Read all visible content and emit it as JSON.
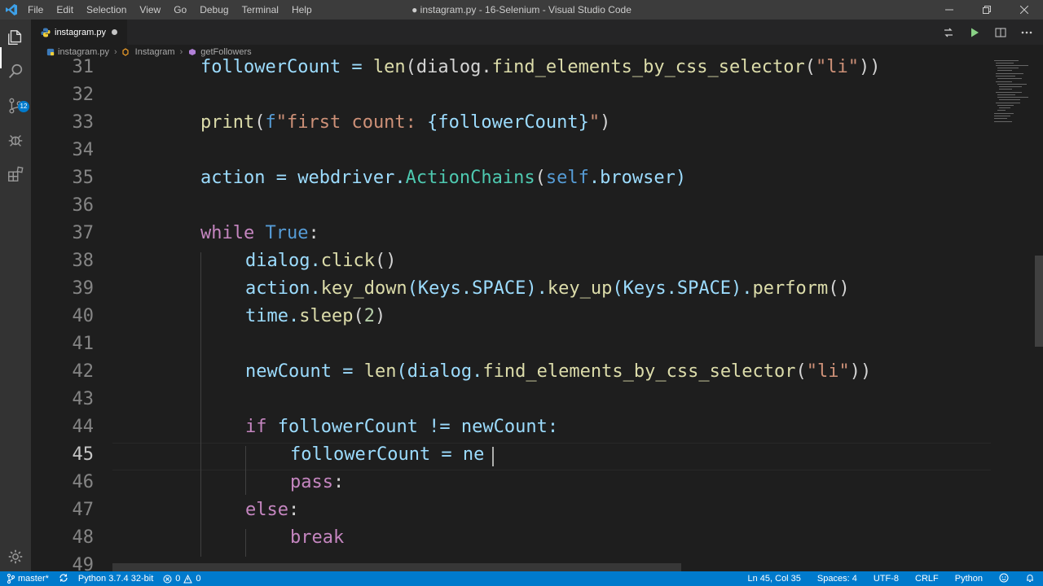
{
  "window": {
    "title": "● instagram.py - 16-Selenium - Visual Studio Code",
    "menu": [
      "File",
      "Edit",
      "Selection",
      "View",
      "Go",
      "Debug",
      "Terminal",
      "Help"
    ]
  },
  "activity": {
    "scm_badge": "12"
  },
  "tabs": [
    {
      "name": "instagram.py",
      "dirty": true
    }
  ],
  "breadcrumb": [
    "instagram.py",
    "Instagram",
    "getFollowers"
  ],
  "editor": {
    "lines": [
      {
        "n": "31",
        "indent": 0
      },
      {
        "n": "32",
        "indent": 0
      },
      {
        "n": "33",
        "indent": 0
      },
      {
        "n": "34",
        "indent": 0
      },
      {
        "n": "35",
        "indent": 0
      },
      {
        "n": "36",
        "indent": 0
      },
      {
        "n": "37",
        "indent": 0
      },
      {
        "n": "38",
        "indent": 1
      },
      {
        "n": "39",
        "indent": 1
      },
      {
        "n": "40",
        "indent": 1
      },
      {
        "n": "41",
        "indent": 1
      },
      {
        "n": "42",
        "indent": 1
      },
      {
        "n": "43",
        "indent": 1
      },
      {
        "n": "44",
        "indent": 1
      },
      {
        "n": "45",
        "indent": 2
      },
      {
        "n": "46",
        "indent": 2
      },
      {
        "n": "47",
        "indent": 1
      },
      {
        "n": "48",
        "indent": 2
      },
      {
        "n": "49",
        "indent": 0
      }
    ],
    "code": {
      "l31": {
        "a": "followerCount = ",
        "b": "len",
        "c": "(dialog.",
        "d": "find_elements_by_css_selector",
        "e": "(",
        "f": "\"li\"",
        "g": "))"
      },
      "l33": {
        "a": "print",
        "b": "(",
        "c": "f",
        "d": "\"first count: ",
        "e": "{followerCount}",
        "f": "\"",
        "g": ")"
      },
      "l35": {
        "a": "action = webdriver.",
        "b": "ActionChains",
        "c": "(",
        "d": "self",
        "e": ".browser)"
      },
      "l37": {
        "a": "while",
        "b": " ",
        "c": "True",
        "d": ":"
      },
      "l38": {
        "a": "dialog.",
        "b": "click",
        "c": "()"
      },
      "l39": {
        "a": "action.",
        "b": "key_down",
        "c": "(Keys.SPACE).",
        "d": "key_up",
        "e": "(Keys.SPACE).",
        "f": "perform",
        "g": "()"
      },
      "l40": {
        "a": "time.",
        "b": "sleep",
        "c": "(",
        "d": "2",
        "e": ")"
      },
      "l42": {
        "a": "newCount = ",
        "b": "len",
        "c": "(dialog.",
        "d": "find_elements_by_css_selector",
        "e": "(",
        "f": "\"li\"",
        "g": "))"
      },
      "l44": {
        "a": "if",
        "b": " followerCount != newCount:"
      },
      "l45": {
        "a": "followerCount = ne"
      },
      "l46": {
        "a": "pass",
        "b": ":"
      },
      "l47": {
        "a": "else",
        "b": ":"
      },
      "l48": {
        "a": "break"
      }
    }
  },
  "status": {
    "branch": "master*",
    "interpreter": "Python 3.7.4 32-bit",
    "errors": "0",
    "warnings": "0",
    "position": "Ln 45, Col 35",
    "spaces": "Spaces: 4",
    "encoding": "UTF-8",
    "eol": "CRLF",
    "language": "Python"
  },
  "colors": {
    "accent": "#007acc",
    "background": "#1e1e1e",
    "keyword": "#569cd6",
    "control": "#c586c0",
    "string": "#ce9178",
    "function": "#dcdcaa",
    "variable": "#9cdcfe",
    "number": "#b5cea8",
    "class": "#4ec9b0"
  }
}
